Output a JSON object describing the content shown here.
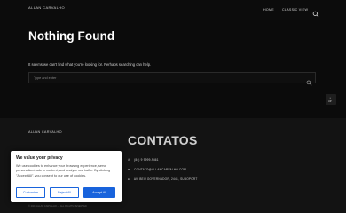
{
  "header": {
    "logo": "ALLAN CARVALHO",
    "nav": [
      {
        "label": "HOME"
      },
      {
        "label": "CLASSIC VIEW"
      }
    ],
    "search_icon": "search-icon"
  },
  "main": {
    "title": "Nothing Found",
    "message": "It seems we can't find what you're looking for. Perhaps searching can help.",
    "search_placeholder": "Type and enter",
    "search_icon": "search-icon"
  },
  "to_top": {
    "label": "UP",
    "icon": "arrow-up-icon"
  },
  "footer": {
    "brand": "ALLAN CARVALHO",
    "contacts_title": "CONTATOS",
    "contacts": [
      {
        "icon": "phone-icon",
        "text": "(84) 9 9999-9461"
      },
      {
        "icon": "mail-icon",
        "text": "CONTATO@ALLANCARVALHO.COM"
      },
      {
        "icon": "location-icon",
        "text": "AV. BEIJ GOVERNADOR, 2441, SUBOPORT"
      }
    ],
    "copyright": "© 2024 ALLAN CARVALHO — ALL RIGHTS RESERVED"
  },
  "cookie_banner": {
    "title": "We value your privacy",
    "text": "We use cookies to enhance your browsing experience, serve personalized ads or content, and analyze our traffic. By clicking \"Accept All\", you consent to our use of cookies.",
    "buttons": {
      "customize": "Customize",
      "reject": "Reject All",
      "accept": "Accept All"
    },
    "accent_color": "#1863dc"
  }
}
